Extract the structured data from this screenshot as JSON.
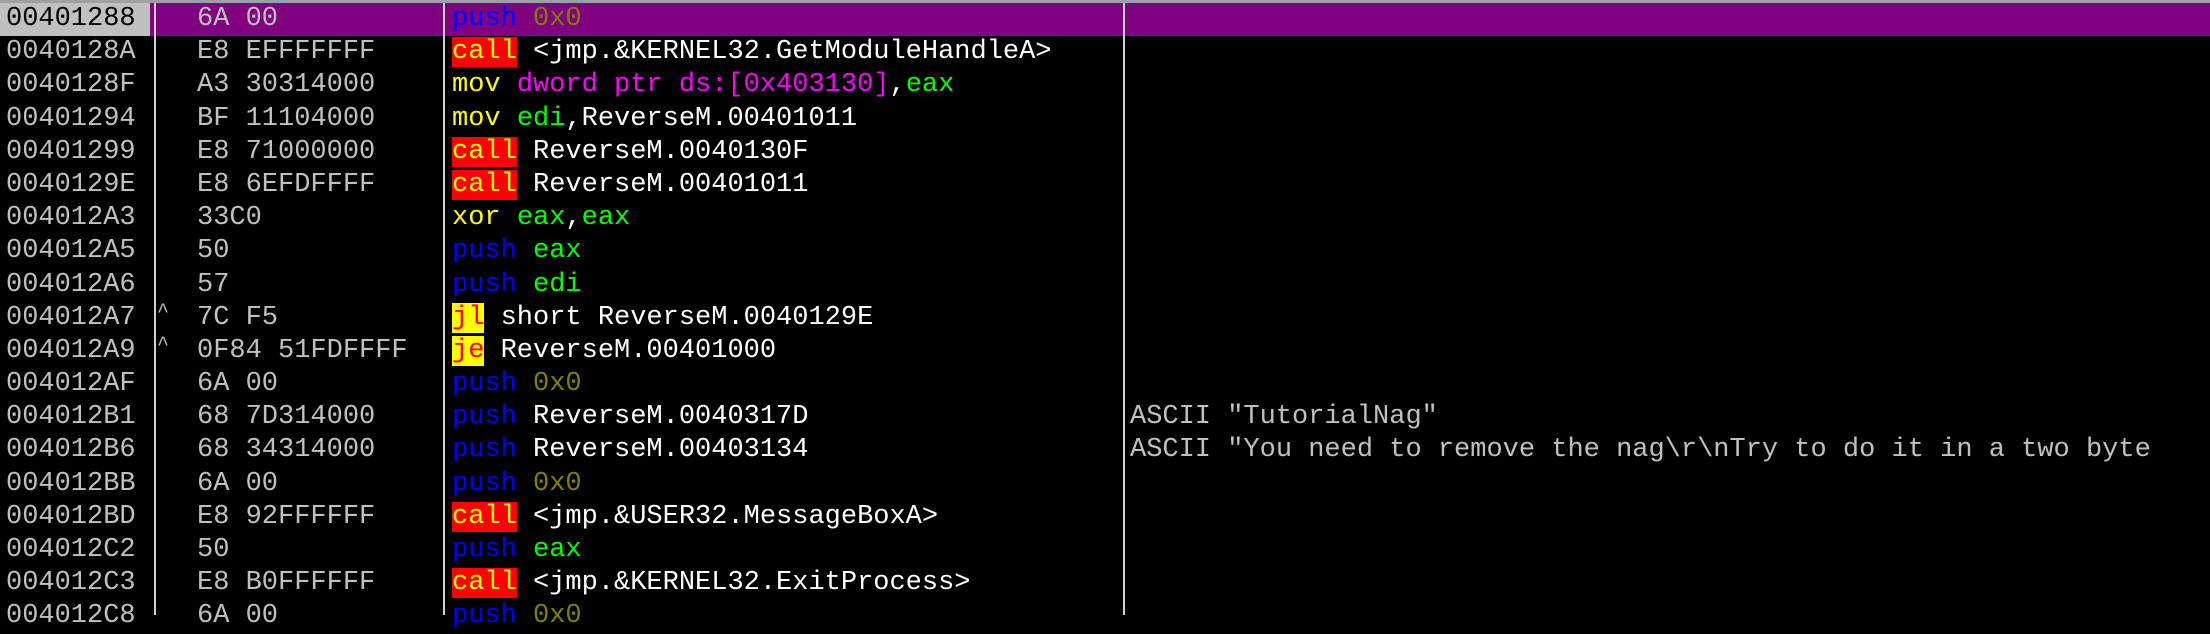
{
  "colors": {
    "selected_row": "#800080",
    "push": "#0000ff",
    "immediate": "#808000",
    "call_bg": "#ff0000",
    "call_fg": "#ffff00",
    "jump_bg": "#ffff00",
    "jump_fg": "#ff0000",
    "mov": "#ffff00",
    "register": "#00ff00",
    "memory": "#ff00ff",
    "operand": "#ffffff",
    "bytes": "#c0c0c0"
  },
  "rows": [
    {
      "addr": "00401288",
      "mark": "",
      "hex": "6A 00",
      "selected": true,
      "tokens": [
        {
          "t": "push",
          "k": "push"
        },
        {
          "t": " ",
          "k": "sep"
        },
        {
          "t": "0x0",
          "k": "imm"
        }
      ],
      "comment": ""
    },
    {
      "addr": "0040128A",
      "mark": "",
      "hex": "E8 EFFFFFFF",
      "tokens": [
        {
          "t": "call",
          "k": "call"
        },
        {
          "t": " <jmp.&KERNEL32.GetModuleHandleA>",
          "k": "txt"
        }
      ],
      "comment": ""
    },
    {
      "addr": "0040128F",
      "mark": "",
      "hex": "A3 30314000",
      "tokens": [
        {
          "t": "mov",
          "k": "mov"
        },
        {
          "t": " ",
          "k": "sep"
        },
        {
          "t": "dword ptr ds:[0x403130]",
          "k": "mem"
        },
        {
          "t": ",",
          "k": "sep"
        },
        {
          "t": "eax",
          "k": "reg"
        }
      ],
      "comment": ""
    },
    {
      "addr": "00401294",
      "mark": "",
      "hex": "BF 11104000",
      "tokens": [
        {
          "t": "mov",
          "k": "mov"
        },
        {
          "t": " ",
          "k": "sep"
        },
        {
          "t": "edi",
          "k": "reg"
        },
        {
          "t": ",ReverseM.00401011",
          "k": "txt"
        }
      ],
      "comment": ""
    },
    {
      "addr": "00401299",
      "mark": "",
      "hex": "E8 71000000",
      "tokens": [
        {
          "t": "call",
          "k": "call"
        },
        {
          "t": " ReverseM.0040130F",
          "k": "txt"
        }
      ],
      "comment": ""
    },
    {
      "addr": "0040129E",
      "mark": "",
      "hex": "E8 6EFDFFFF",
      "tokens": [
        {
          "t": "call",
          "k": "call"
        },
        {
          "t": " ReverseM.00401011",
          "k": "txt"
        }
      ],
      "comment": ""
    },
    {
      "addr": "004012A3",
      "mark": "",
      "hex": "33C0",
      "tokens": [
        {
          "t": "xor",
          "k": "mov"
        },
        {
          "t": " ",
          "k": "sep"
        },
        {
          "t": "eax",
          "k": "reg"
        },
        {
          "t": ",",
          "k": "sep"
        },
        {
          "t": "eax",
          "k": "reg"
        }
      ],
      "comment": ""
    },
    {
      "addr": "004012A5",
      "mark": "",
      "hex": "50",
      "tokens": [
        {
          "t": "push",
          "k": "push"
        },
        {
          "t": " ",
          "k": "sep"
        },
        {
          "t": "eax",
          "k": "reg"
        }
      ],
      "comment": ""
    },
    {
      "addr": "004012A6",
      "mark": "",
      "hex": "57",
      "tokens": [
        {
          "t": "push",
          "k": "push"
        },
        {
          "t": " ",
          "k": "sep"
        },
        {
          "t": "edi",
          "k": "reg"
        }
      ],
      "comment": ""
    },
    {
      "addr": "004012A7",
      "mark": "^",
      "hex": "7C F5",
      "tokens": [
        {
          "t": "jl",
          "k": "jmp"
        },
        {
          "t": " short ReverseM.0040129E",
          "k": "txt"
        }
      ],
      "comment": ""
    },
    {
      "addr": "004012A9",
      "mark": "^",
      "hex": "0F84 51FDFFFF",
      "tokens": [
        {
          "t": "je",
          "k": "jmp"
        },
        {
          "t": " ReverseM.00401000",
          "k": "txt"
        }
      ],
      "comment": ""
    },
    {
      "addr": "004012AF",
      "mark": "",
      "hex": "6A 00",
      "tokens": [
        {
          "t": "push",
          "k": "push"
        },
        {
          "t": " ",
          "k": "sep"
        },
        {
          "t": "0x0",
          "k": "imm"
        }
      ],
      "comment": ""
    },
    {
      "addr": "004012B1",
      "mark": "",
      "hex": "68 7D314000",
      "tokens": [
        {
          "t": "push",
          "k": "push"
        },
        {
          "t": " ReverseM.0040317D",
          "k": "txt"
        }
      ],
      "comment": "ASCII \"TutorialNag\""
    },
    {
      "addr": "004012B6",
      "mark": "",
      "hex": "68 34314000",
      "tokens": [
        {
          "t": "push",
          "k": "push"
        },
        {
          "t": " ReverseM.00403134",
          "k": "txt"
        }
      ],
      "comment": "ASCII \"You need to remove the nag\\r\\nTry to do it in a two byte"
    },
    {
      "addr": "004012BB",
      "mark": "",
      "hex": "6A 00",
      "tokens": [
        {
          "t": "push",
          "k": "push"
        },
        {
          "t": " ",
          "k": "sep"
        },
        {
          "t": "0x0",
          "k": "imm"
        }
      ],
      "comment": ""
    },
    {
      "addr": "004012BD",
      "mark": "",
      "hex": "E8 92FFFFFF",
      "tokens": [
        {
          "t": "call",
          "k": "call"
        },
        {
          "t": " <jmp.&USER32.MessageBoxA>",
          "k": "txt"
        }
      ],
      "comment": ""
    },
    {
      "addr": "004012C2",
      "mark": "",
      "hex": "50",
      "tokens": [
        {
          "t": "push",
          "k": "push"
        },
        {
          "t": " ",
          "k": "sep"
        },
        {
          "t": "eax",
          "k": "reg"
        }
      ],
      "comment": ""
    },
    {
      "addr": "004012C3",
      "mark": "",
      "hex": "E8 B0FFFFFF",
      "tokens": [
        {
          "t": "call",
          "k": "call"
        },
        {
          "t": " <jmp.&KERNEL32.ExitProcess>",
          "k": "txt"
        }
      ],
      "comment": ""
    },
    {
      "addr": "004012C8",
      "mark": "",
      "hex": "6A 00",
      "tokens": [
        {
          "t": "push",
          "k": "push"
        },
        {
          "t": " ",
          "k": "sep"
        },
        {
          "t": "0x0",
          "k": "imm"
        }
      ],
      "comment": ""
    }
  ]
}
